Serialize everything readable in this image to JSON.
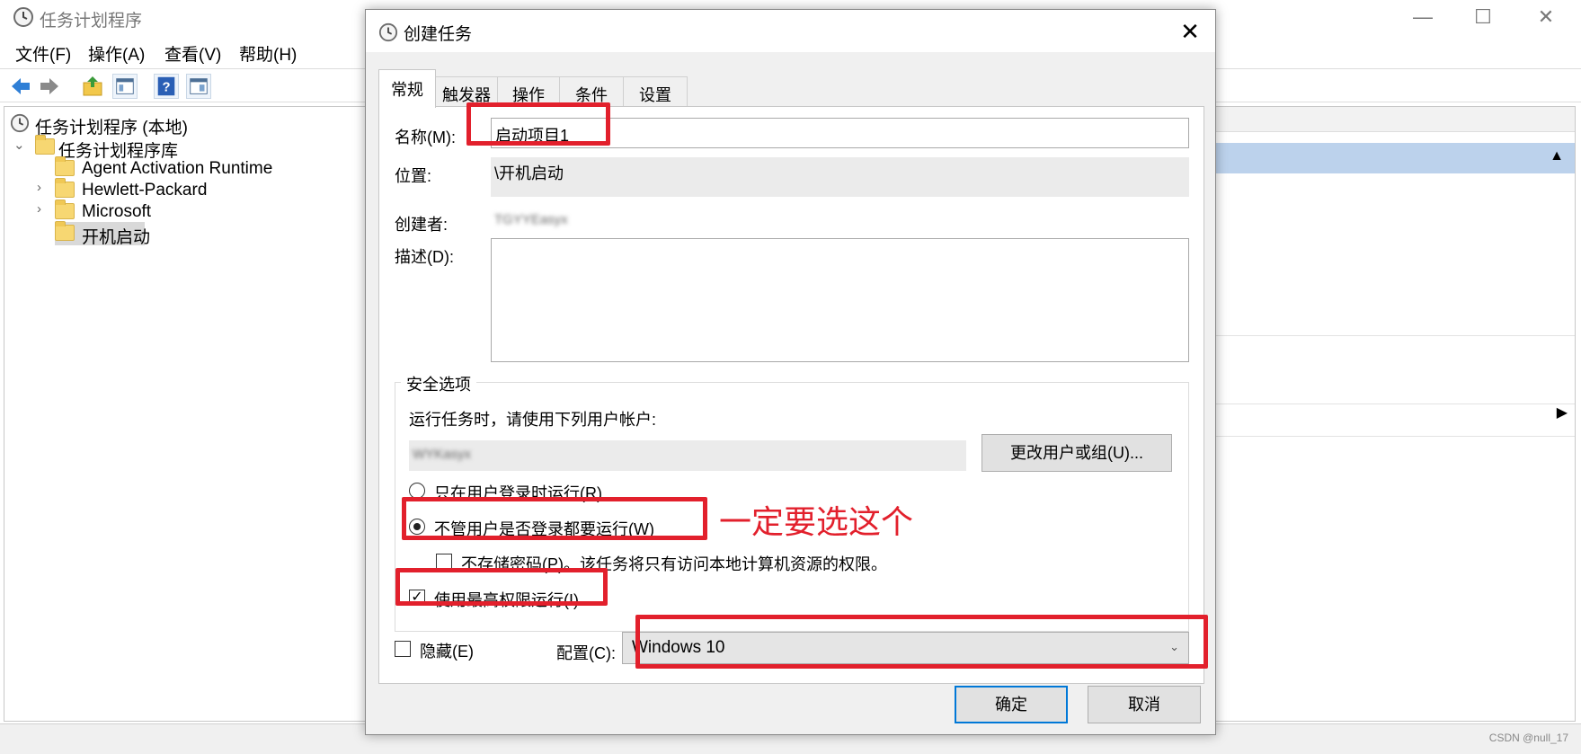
{
  "main_window": {
    "title": "任务计划程序",
    "controls": {
      "minimize": "—",
      "maximize": "☐",
      "close": "✕"
    },
    "menu": [
      "文件(F)",
      "操作(A)",
      "查看(V)",
      "帮助(H)"
    ],
    "tree": {
      "root": "任务计划程序 (本地)",
      "library": "任务计划程序库",
      "folders": [
        "Agent Activation Runtime",
        "Hewlett-Packard",
        "Microsoft",
        "开机启动"
      ],
      "selected": "开机启动"
    }
  },
  "dialog": {
    "title": "创建任务",
    "tabs": [
      "常规",
      "触发器",
      "操作",
      "条件",
      "设置"
    ],
    "active_tab": "常规",
    "name_label": "名称(M):",
    "name_value": "启动项目1",
    "location_label": "位置:",
    "location_value": "\\开机启动",
    "author_label": "创建者:",
    "author_value": "TGYYEasyx",
    "description_label": "描述(D):",
    "description_value": "",
    "security": {
      "legend": "安全选项",
      "run_as_label": "运行任务时，请使用下列用户帐户:",
      "user_value": "WYKasyx",
      "change_user_button": "更改用户或组(U)...",
      "radio_logged_on": "只在用户登录时运行(R)",
      "radio_whether_logged": "不管用户是否登录都要运行(W)",
      "selected_radio": "whether_logged",
      "no_store_password": "不存储密码(P)。该任务将只有访问本地计算机资源的权限。",
      "no_store_password_checked": false,
      "highest_privileges": "使用最高权限运行(I)",
      "highest_privileges_checked": true
    },
    "hidden_label": "隐藏(E)",
    "hidden_checked": false,
    "configure_label": "配置(C):",
    "configure_value": "Windows 10",
    "ok_button": "确定",
    "cancel_button": "取消"
  },
  "annotation": {
    "text": "一定要选这个",
    "color": "#e2202c"
  },
  "watermark": "CSDN @null_17",
  "check_mark": "✓"
}
